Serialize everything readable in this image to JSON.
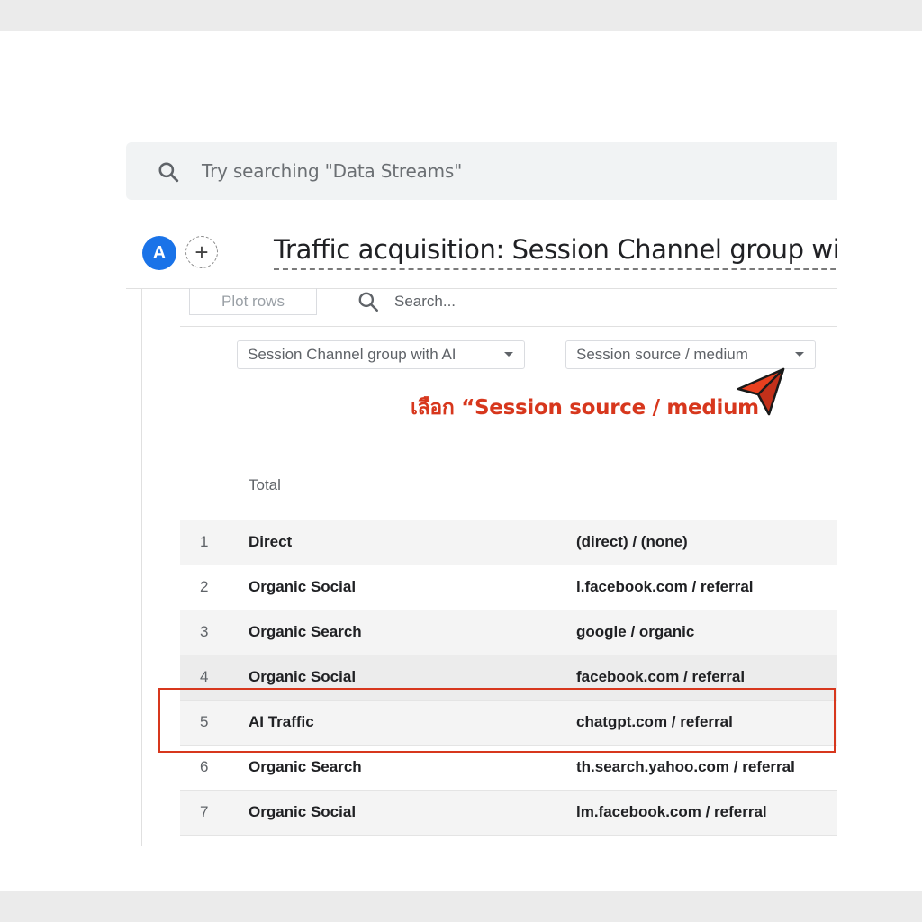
{
  "search": {
    "placeholder": "Try searching \"Data Streams\""
  },
  "header": {
    "avatar_letter": "A",
    "add_symbol": "+",
    "title": "Traffic acquisition: Session Channel group with AI"
  },
  "toolbar": {
    "plot_rows_label": "Plot rows",
    "search_placeholder": "Search..."
  },
  "dimensions": {
    "primary": "Session Channel group with AI",
    "secondary": "Session source / medium"
  },
  "annotation": {
    "text": "เลือก  “Session source / medium",
    "color": "#d7371d"
  },
  "table": {
    "total_label": "Total",
    "rows": [
      {
        "num": "1",
        "channel": "Direct",
        "source": "(direct) / (none)"
      },
      {
        "num": "2",
        "channel": "Organic Social",
        "source": "l.facebook.com / referral"
      },
      {
        "num": "3",
        "channel": "Organic Search",
        "source": "google / organic"
      },
      {
        "num": "4",
        "channel": "Organic Social",
        "source": "facebook.com / referral"
      },
      {
        "num": "5",
        "channel": "AI Traffic",
        "source": "chatgpt.com / referral"
      },
      {
        "num": "6",
        "channel": "Organic Search",
        "source": "th.search.yahoo.com / referral"
      },
      {
        "num": "7",
        "channel": "Organic Social",
        "source": "lm.facebook.com / referral"
      }
    ],
    "highlighted_row": "5"
  },
  "icons": {
    "search": "search-icon",
    "add": "plus-icon",
    "dropdown": "chevron-down-icon",
    "pointer": "arrow-pointer-icon"
  },
  "colors": {
    "accent_blue": "#1a73e8",
    "highlight_red": "#d7371d"
  }
}
